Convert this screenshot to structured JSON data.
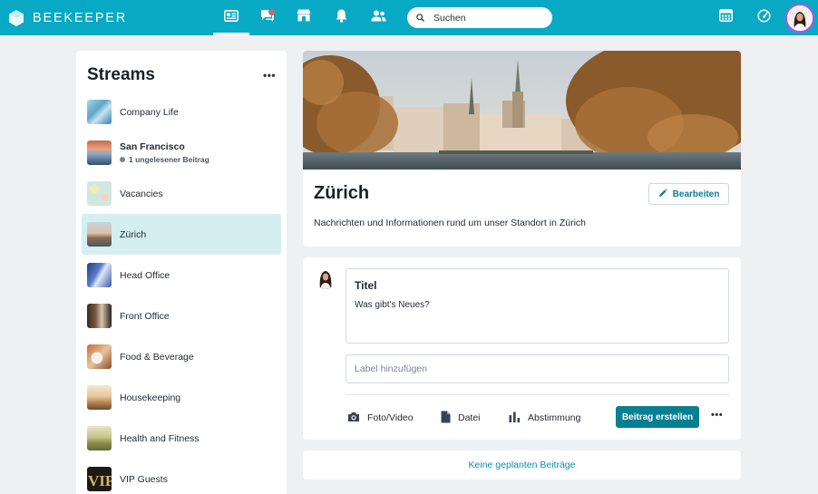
{
  "brand": {
    "name": "BEEKEEPER",
    "color": "#08a9c4",
    "accent": "#097f92"
  },
  "topbar": {
    "nav_icons": [
      "news-feed-icon",
      "chat-icon",
      "shop-icon",
      "bell-icon",
      "people-icon"
    ],
    "chat_has_unread": true,
    "search_placeholder": "Suchen",
    "right_icons": [
      "apps-grid-icon",
      "speedometer-icon",
      "user-avatar"
    ]
  },
  "sidebar": {
    "title": "Streams",
    "more": "•••",
    "items": [
      {
        "label": "Company Life",
        "thumb": "company-life"
      },
      {
        "label": "San Francisco",
        "bold": true,
        "sub": "1 ungelesener Beitrag",
        "thumb": "san-francisco"
      },
      {
        "label": "Vacancies",
        "thumb": "vacancies"
      },
      {
        "label": "Zürich",
        "selected": true,
        "thumb": "zurich"
      },
      {
        "label": "Head Office",
        "thumb": "head-office"
      },
      {
        "label": "Front Office",
        "thumb": "front-office"
      },
      {
        "label": "Food & Beverage",
        "thumb": "food-beverage"
      },
      {
        "label": "Housekeeping",
        "thumb": "housekeeping"
      },
      {
        "label": "Health and Fitness",
        "thumb": "health-fitness"
      },
      {
        "label": "VIP Guests",
        "thumb": "vip-guests"
      }
    ]
  },
  "stream": {
    "title": "Zürich",
    "edit_label": "Bearbeiten",
    "description": "Nachrichten und Informationen rund um unser Standort in Zürich"
  },
  "composer": {
    "title_placeholder": "Titel",
    "body_placeholder": "Was gibt's Neues?",
    "label_placeholder": "Label hinzufügen",
    "actions": {
      "photo": "Foto/Video",
      "file": "Datei",
      "poll": "Abstimmung"
    },
    "submit_label": "Beitrag erstellen",
    "more": "•••"
  },
  "scheduled": {
    "label": "Keine geplanten Beiträge"
  }
}
